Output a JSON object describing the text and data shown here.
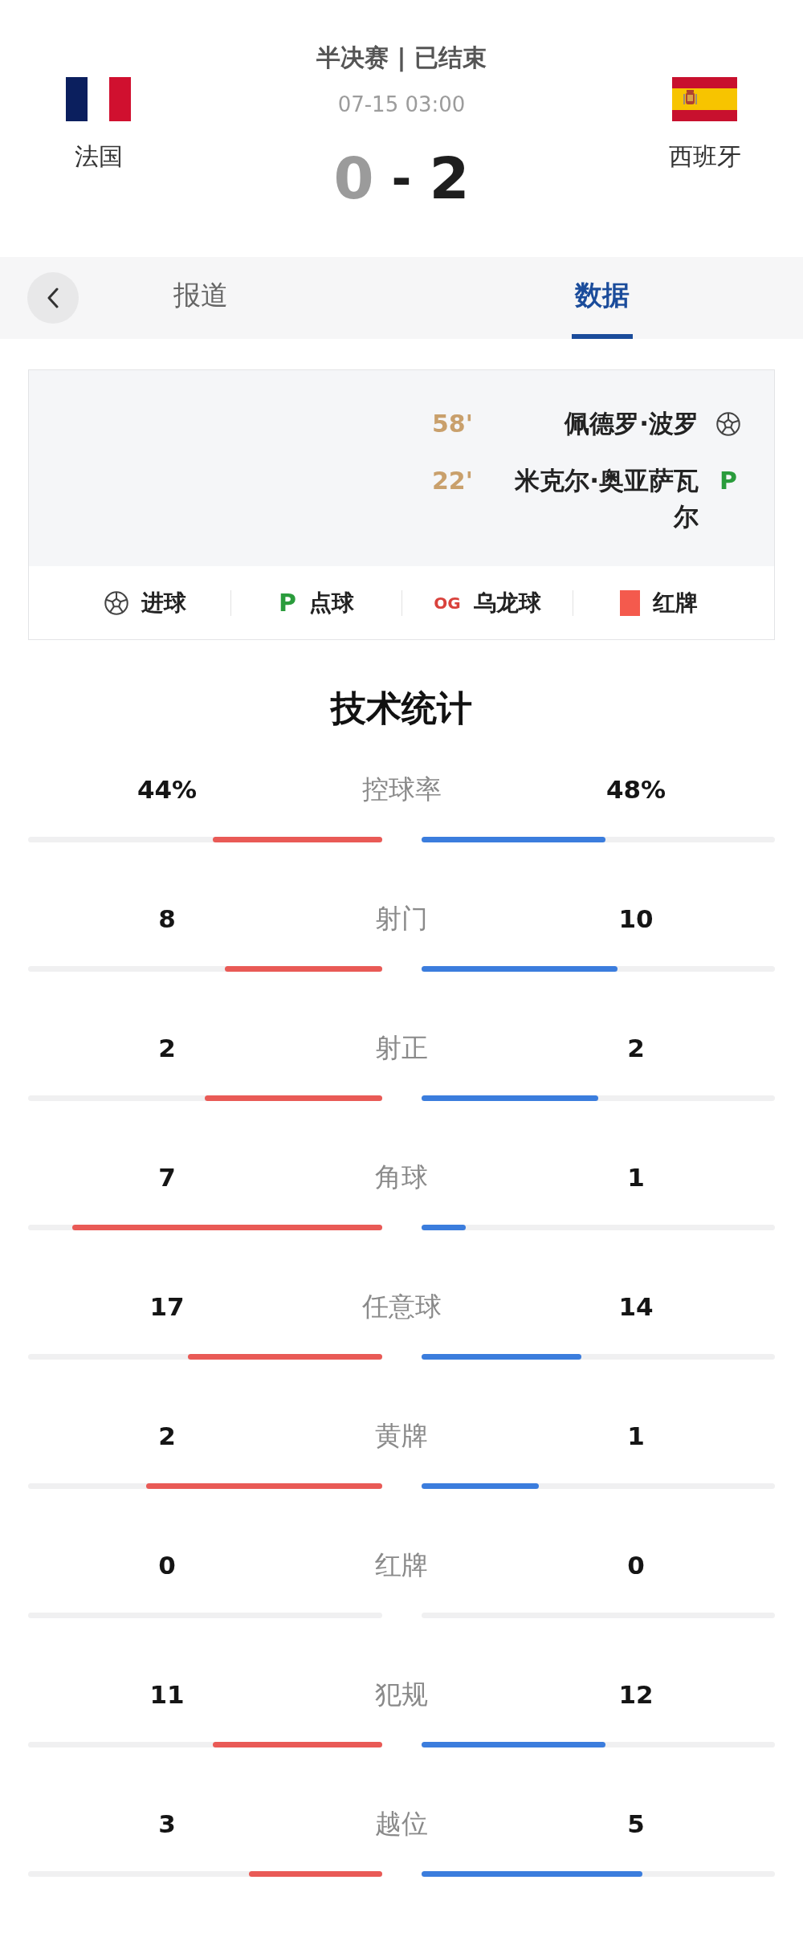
{
  "match": {
    "stage_status": "半决赛 | 已结束",
    "time": "07-15 03:00",
    "score_separator": "-",
    "home": {
      "name": "法国",
      "score": "0",
      "winner": false
    },
    "away": {
      "name": "西班牙",
      "score": "2",
      "winner": true
    }
  },
  "tabs": [
    {
      "label": "报道",
      "selected": false
    },
    {
      "label": "数据",
      "selected": true
    }
  ],
  "events": [
    {
      "minute": "58'",
      "player": "佩德罗·波罗",
      "kind": "goal"
    },
    {
      "minute": "22'",
      "player": "米克尔·奥亚萨瓦尔",
      "kind": "penalty",
      "mark": "P"
    }
  ],
  "legend": [
    {
      "kind": "goal",
      "label": "进球"
    },
    {
      "kind": "penalty",
      "mark": "P",
      "label": "点球"
    },
    {
      "kind": "own_goal",
      "mark": "OG",
      "label": "乌龙球"
    },
    {
      "kind": "red_card",
      "label": "红牌"
    }
  ],
  "stats": {
    "title": "技术统计",
    "rows": [
      {
        "label": "控球率",
        "home": {
          "value": "44%",
          "level": 0.478
        },
        "away": {
          "value": "48%",
          "level": 0.522
        }
      },
      {
        "label": "射门",
        "home": {
          "value": "8",
          "level": 0.444
        },
        "away": {
          "value": "10",
          "level": 0.556
        }
      },
      {
        "label": "射正",
        "home": {
          "value": "2",
          "level": 0.5
        },
        "away": {
          "value": "2",
          "level": 0.5
        }
      },
      {
        "label": "角球",
        "home": {
          "value": "7",
          "level": 0.875
        },
        "away": {
          "value": "1",
          "level": 0.125
        }
      },
      {
        "label": "任意球",
        "home": {
          "value": "17",
          "level": 0.548
        },
        "away": {
          "value": "14",
          "level": 0.452
        }
      },
      {
        "label": "黄牌",
        "home": {
          "value": "2",
          "level": 0.667
        },
        "away": {
          "value": "1",
          "level": 0.333
        }
      },
      {
        "label": "红牌",
        "home": {
          "value": "0"
        },
        "away": {
          "value": "0"
        }
      },
      {
        "label": "犯规",
        "home": {
          "value": "11",
          "level": 0.478
        },
        "away": {
          "value": "12",
          "level": 0.522
        }
      },
      {
        "label": "越位",
        "home": {
          "value": "3",
          "level": 0.375
        },
        "away": {
          "value": "5",
          "level": 0.625
        }
      }
    ]
  }
}
